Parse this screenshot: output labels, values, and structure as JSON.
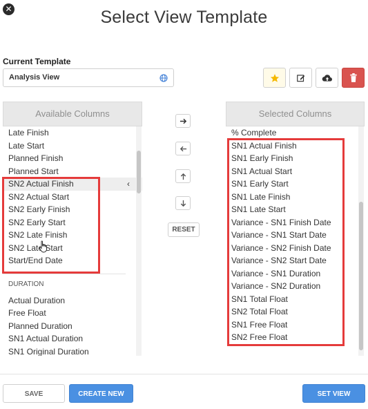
{
  "dialog": {
    "title": "Select View Template"
  },
  "current_template": {
    "label": "Current Template",
    "value": "Analysis View"
  },
  "available": {
    "header": "Available Columns",
    "items": [
      "Late Finish",
      "Late Start",
      "Planned Finish",
      "Planned Start",
      "SN2 Actual Finish",
      "SN2 Actual Start",
      "SN2 Early Finish",
      "SN2 Early Start",
      "SN2 Late Finish",
      "SN2 Late Start",
      "Start/End Date"
    ],
    "section": "DURATION",
    "duration_items": [
      "Actual Duration",
      "Free Float",
      "Planned Duration",
      "SN1 Actual Duration",
      "SN1 Original Duration"
    ],
    "collapse_glyph": "‹"
  },
  "selected": {
    "header": "Selected Columns",
    "items": [
      "% Complete",
      "SN1 Actual Finish",
      "SN1 Early Finish",
      "SN1 Actual Start",
      "SN1 Early Start",
      "SN1 Late Finish",
      "SN1 Late Start",
      "Variance - SN1 Finish Date",
      "Variance - SN1 Start Date",
      "Variance - SN2 Finish Date",
      "Variance - SN2 Start Date",
      "Variance - SN1 Duration",
      "Variance - SN2 Duration",
      "SN1 Total Float",
      "SN2 Total Float",
      "SN1 Free Float",
      "SN2 Free Float"
    ]
  },
  "actions": {
    "reset": "RESET",
    "save": "SAVE",
    "create_new": "CREATE NEW",
    "set_view": "SET VIEW"
  },
  "icons": {
    "close": "close-icon",
    "globe": "globe-icon",
    "favorite": "star-icon",
    "edit": "edit-icon",
    "cloud": "cloud-upload-icon",
    "delete": "trash-icon",
    "move_right": "arrow-right-icon",
    "move_left": "arrow-left-icon",
    "move_up": "arrow-up-icon",
    "move_down": "arrow-down-icon"
  },
  "colors": {
    "accent": "#4a90e2",
    "danger": "#d9534f",
    "annotation": "#e53b3b",
    "star": "#f5b800"
  }
}
